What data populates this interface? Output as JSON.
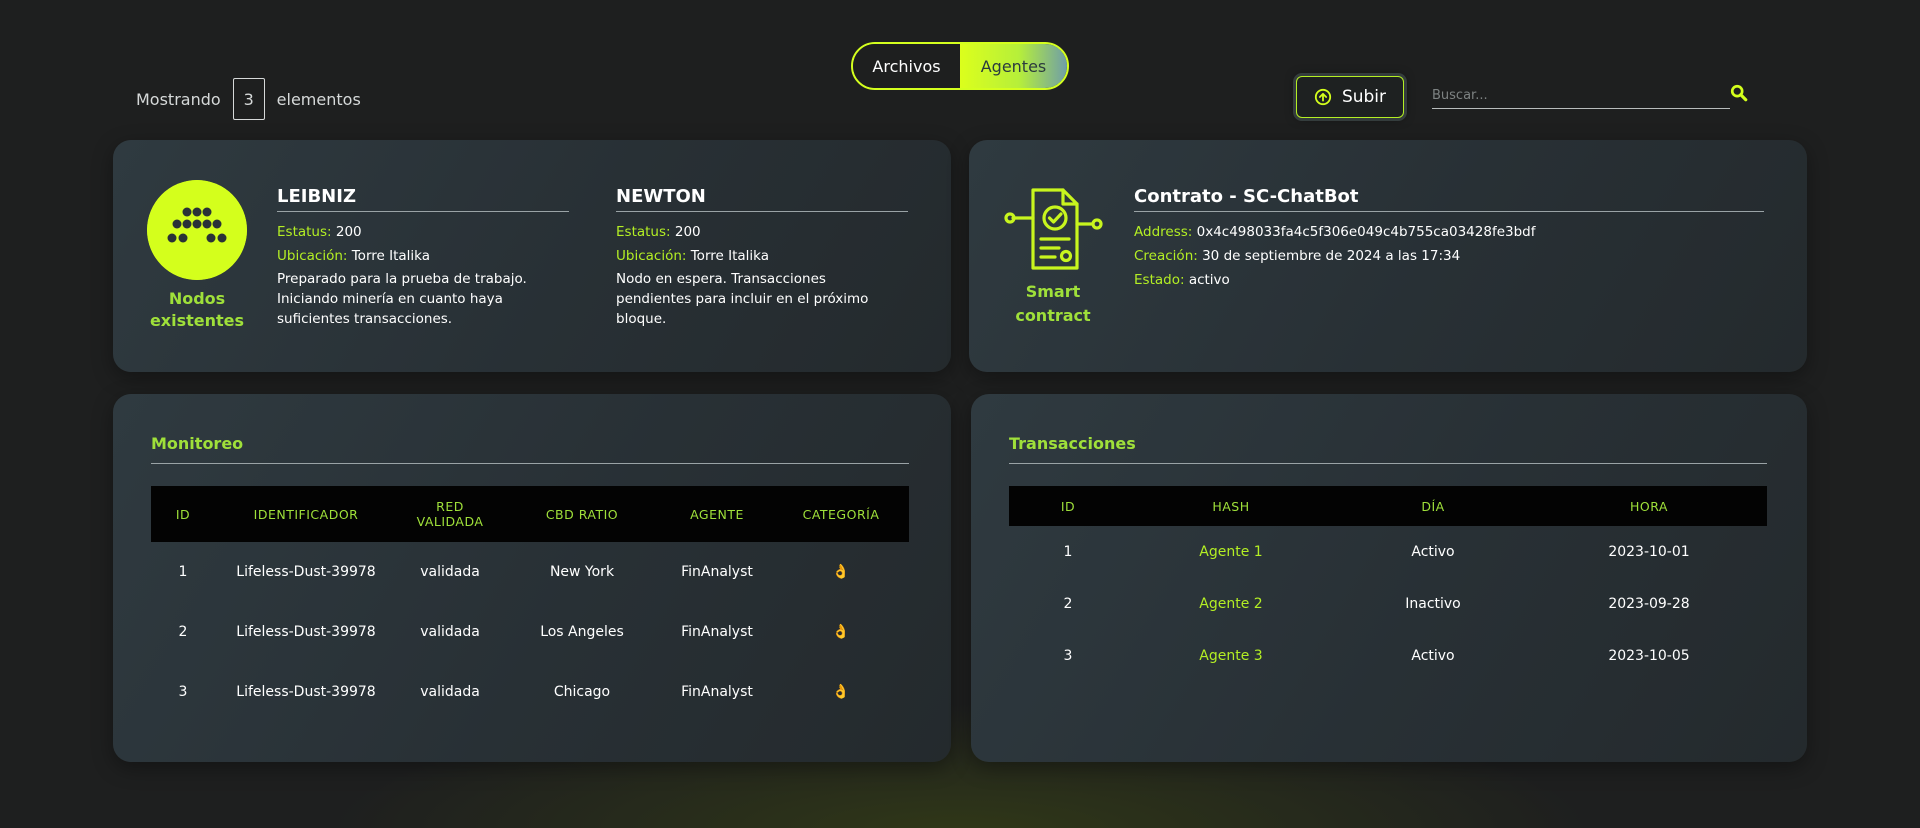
{
  "toolbar": {
    "showing_prefix": "Mostrando",
    "showing_count": "3",
    "showing_suffix": "elementos",
    "tabs": [
      {
        "label": "Archivos",
        "active": false
      },
      {
        "label": "Agentes",
        "active": true
      }
    ],
    "upload_label": "Subir",
    "search_placeholder": "Buscar..."
  },
  "nodes": {
    "caption_line1": "Nodos",
    "caption_line2": "existentes",
    "items": [
      {
        "name": "LEIBNIZ",
        "status_label": "Estatus:",
        "status_value": "200",
        "location_label": "Ubicación:",
        "location_value": "Torre Italika",
        "description_lines": [
          "Preparado para la prueba de trabajo.",
          "Iniciando minería en cuanto haya",
          "suficientes transacciones."
        ]
      },
      {
        "name": "NEWTON",
        "status_label": "Estatus:",
        "status_value": "200",
        "location_label": "Ubicación:",
        "location_value": "Torre Italika",
        "description_lines": [
          "Nodo en espera. Transacciones",
          "pendientes para incluir en el próximo",
          "bloque."
        ]
      }
    ]
  },
  "contract": {
    "caption_line1": "Smart",
    "caption_line2": "contract",
    "title": "Contrato - SC-ChatBot",
    "address_label": "Address:",
    "address_value": "0x4c498033fa4c5f306e049c4b755ca03428fe3bdf",
    "created_label": "Creación:",
    "created_value": "30 de septiembre de 2024 a las 17:34",
    "state_label": "Estado:",
    "state_value": "activo"
  },
  "monitor": {
    "title": "Monitoreo",
    "columns": [
      "ID",
      "IDENTIFICADOR",
      "RED VALIDADA",
      "CBD RATIO",
      "AGENTE",
      "CATEGORÍA"
    ],
    "rows": [
      {
        "id": "1",
        "identifier": "Lifeless-Dust-39978",
        "network": "validada",
        "ratio": "New York",
        "agent": "FinAnalyst",
        "category": "👌"
      },
      {
        "id": "2",
        "identifier": "Lifeless-Dust-39978",
        "network": "validada",
        "ratio": "Los Angeles",
        "agent": "FinAnalyst",
        "category": "👌"
      },
      {
        "id": "3",
        "identifier": "Lifeless-Dust-39978",
        "network": "validada",
        "ratio": "Chicago",
        "agent": "FinAnalyst",
        "category": "👌"
      }
    ]
  },
  "transactions": {
    "title": "Transacciones",
    "columns": [
      "ID",
      "HASH",
      "DÍA",
      "HORA"
    ],
    "rows": [
      {
        "id": "1",
        "hash": "Agente 1",
        "day": "Activo",
        "time": "2023-10-01"
      },
      {
        "id": "2",
        "hash": "Agente 2",
        "day": "Inactivo",
        "time": "2023-09-28"
      },
      {
        "id": "3",
        "hash": "Agente 3",
        "day": "Activo",
        "time": "2023-10-05"
      }
    ]
  },
  "colors": {
    "accent": "#b4ef24",
    "accent_bright": "#d4ff1c",
    "background": "#1e1f1f",
    "card": "#2b3439"
  }
}
